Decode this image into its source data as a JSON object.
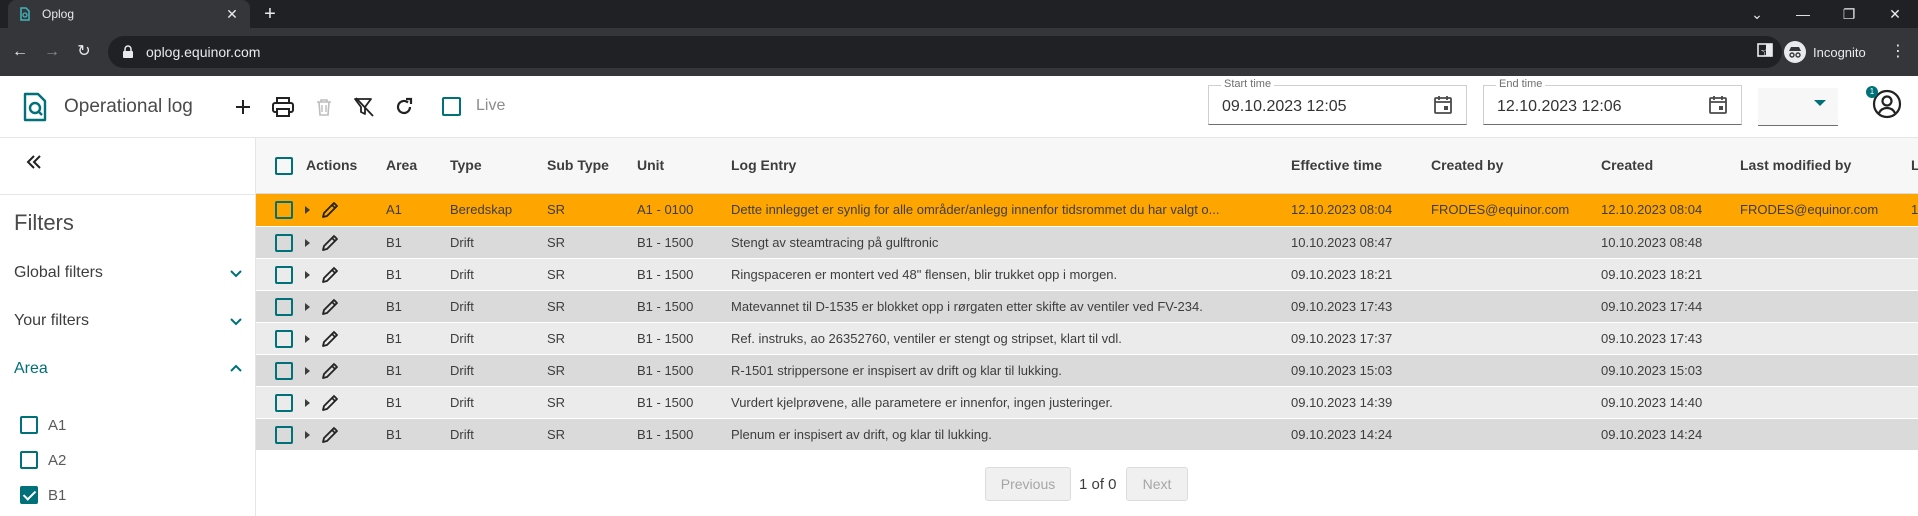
{
  "browser": {
    "tab_title": "Oplog",
    "url": "oplog.equinor.com",
    "profile_label": "Incognito"
  },
  "app": {
    "title": "Operational log",
    "live_label": "Live",
    "live_checked": false,
    "start_time": {
      "label": "Start time",
      "value": "09.10.2023 12:05"
    },
    "end_time": {
      "label": "End time",
      "value": "12.10.2023 12:06"
    },
    "select_value": "",
    "notification_count": "1",
    "accent_color": "#007079",
    "highlight_color": "#ffa500"
  },
  "sidebar": {
    "filters_title": "Filters",
    "sections": [
      {
        "label": "Global filters",
        "expanded": false
      },
      {
        "label": "Your filters",
        "expanded": false
      },
      {
        "label": "Area",
        "expanded": true
      }
    ],
    "area_options": [
      {
        "label": "A1",
        "checked": false
      },
      {
        "label": "A2",
        "checked": false
      },
      {
        "label": "B1",
        "checked": true
      }
    ]
  },
  "table": {
    "columns": [
      "Actions",
      "Area",
      "Type",
      "Sub Type",
      "Unit",
      "Log Entry",
      "Effective time",
      "Created by",
      "Created",
      "Last modified by",
      "L"
    ],
    "rows": [
      {
        "area": "A1",
        "type": "Beredskap",
        "subtype": "SR",
        "unit": "A1 - 0100",
        "entry": "Dette innlegget er synlig for alle områder/anlegg innenfor tidsrommet du har valgt o...",
        "effective": "12.10.2023 08:04",
        "created_by": "FRODES@equinor.com",
        "created": "12.10.2023 08:04",
        "modified_by": "FRODES@equinor.com",
        "last": "1",
        "highlight": true
      },
      {
        "area": "B1",
        "type": "Drift",
        "subtype": "SR",
        "unit": "B1 - 1500",
        "entry": "Stengt av steamtracing på gulftronic",
        "effective": "10.10.2023 08:47",
        "created_by": "",
        "created": "10.10.2023 08:48",
        "modified_by": "",
        "last": ""
      },
      {
        "area": "B1",
        "type": "Drift",
        "subtype": "SR",
        "unit": "B1 - 1500",
        "entry": "Ringspaceren er montert ved 48\" flensen, blir trukket opp i morgen.",
        "effective": "09.10.2023 18:21",
        "created_by": "",
        "created": "09.10.2023 18:21",
        "modified_by": "",
        "last": ""
      },
      {
        "area": "B1",
        "type": "Drift",
        "subtype": "SR",
        "unit": "B1 - 1500",
        "entry": "Matevannet til D-1535 er blokket opp i rørgaten etter skifte av ventiler ved FV-234.",
        "effective": "09.10.2023 17:43",
        "created_by": "",
        "created": "09.10.2023 17:44",
        "modified_by": "",
        "last": ""
      },
      {
        "area": "B1",
        "type": "Drift",
        "subtype": "SR",
        "unit": "B1 - 1500",
        "entry": "Ref. instruks, ao 26352760, ventiler er stengt og stripset, klart til vdl.",
        "effective": "09.10.2023 17:37",
        "created_by": "",
        "created": "09.10.2023 17:43",
        "modified_by": "",
        "last": ""
      },
      {
        "area": "B1",
        "type": "Drift",
        "subtype": "SR",
        "unit": "B1 - 1500",
        "entry": "R-1501 strippersone er inspisert av drift og klar til lukking.",
        "effective": "09.10.2023 15:03",
        "created_by": "",
        "created": "09.10.2023 15:03",
        "modified_by": "",
        "last": ""
      },
      {
        "area": "B1",
        "type": "Drift",
        "subtype": "SR",
        "unit": "B1 - 1500",
        "entry": "Vurdert kjelprøvene, alle parametere er innenfor, ingen justeringer.",
        "effective": "09.10.2023 14:39",
        "created_by": "",
        "created": "09.10.2023 14:40",
        "modified_by": "",
        "last": ""
      },
      {
        "area": "B1",
        "type": "Drift",
        "subtype": "SR",
        "unit": "B1 - 1500",
        "entry": "Plenum er inspisert av drift, og klar til lukking.",
        "effective": "09.10.2023 14:24",
        "created_by": "",
        "created": "09.10.2023 14:24",
        "modified_by": "",
        "last": ""
      }
    ]
  },
  "pager": {
    "previous_label": "Previous",
    "page_text": "1 of 0",
    "next_label": "Next"
  }
}
